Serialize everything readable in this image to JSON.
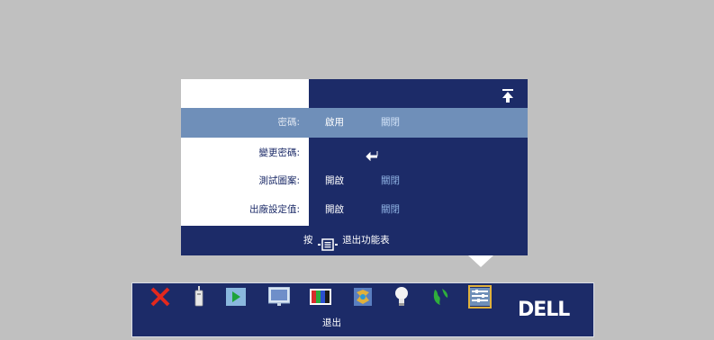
{
  "menu": {
    "rows": [
      {
        "label": "密碼:",
        "opt_a": "啟用",
        "opt_b": "關閉",
        "selected": true
      },
      {
        "label": "變更密碼:",
        "opt_a": "",
        "opt_b": "",
        "selected": false
      },
      {
        "label": "測試圖案:",
        "opt_a": "開啟",
        "opt_b": "關閉",
        "selected": false
      },
      {
        "label": "出廠設定值:",
        "opt_a": "開啟",
        "opt_b": "關閉",
        "selected": false
      }
    ],
    "footer": {
      "prefix": "按",
      "suffix": "退出功能表"
    }
  },
  "toolbar": {
    "hover_label": "退出",
    "brand": "DELL",
    "items": [
      {
        "icon": "close-x-icon"
      },
      {
        "icon": "input-source-icon"
      },
      {
        "icon": "play-icon"
      },
      {
        "icon": "display-screen-icon"
      },
      {
        "icon": "color-bars-icon"
      },
      {
        "icon": "image-settings-icon"
      },
      {
        "icon": "lamp-icon"
      },
      {
        "icon": "globe-language-icon"
      },
      {
        "icon": "management-icon"
      }
    ],
    "selected_index": 8
  },
  "colors": {
    "background": "#c0c0c0",
    "panel": "#1c2b68",
    "selected_row": "#6f8fb9",
    "highlight": "#e0b13c"
  }
}
